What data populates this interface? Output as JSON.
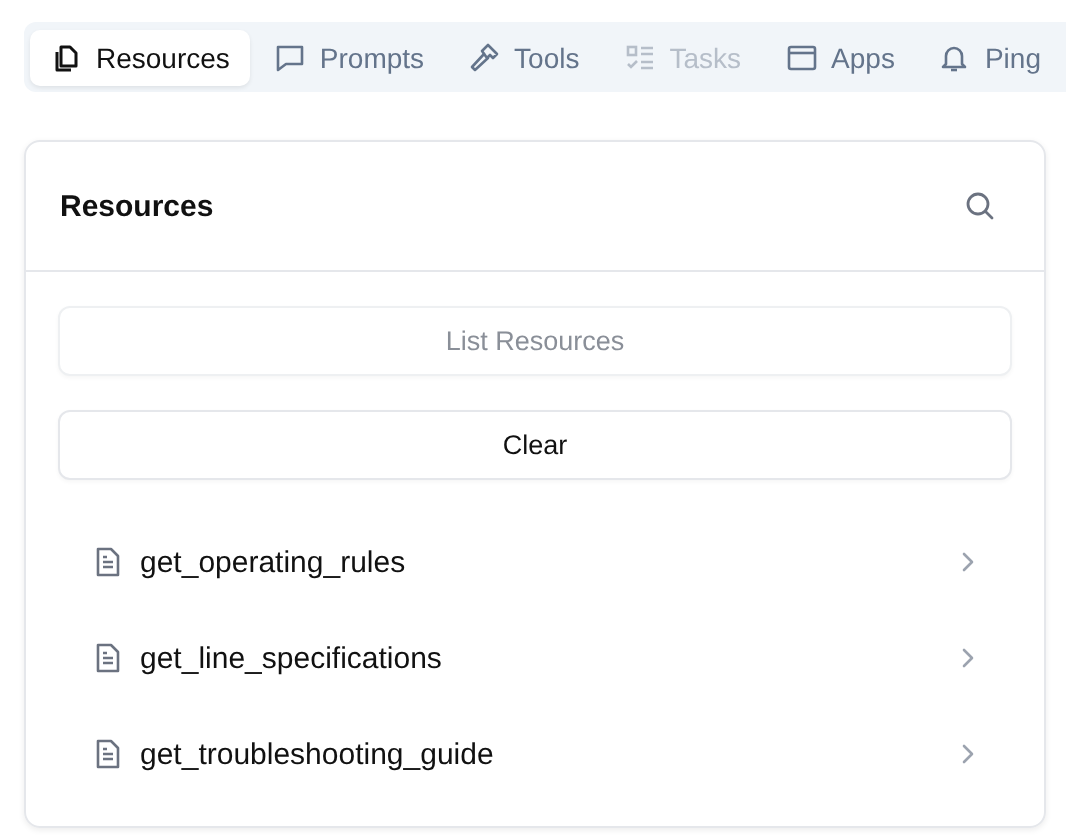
{
  "tabs": [
    {
      "label": "Resources",
      "kind": "copy",
      "selected": true,
      "disabled": false
    },
    {
      "label": "Prompts",
      "kind": "message",
      "selected": false,
      "disabled": false
    },
    {
      "label": "Tools",
      "kind": "hammer",
      "selected": false,
      "disabled": false
    },
    {
      "label": "Tasks",
      "kind": "checklist",
      "selected": false,
      "disabled": true
    },
    {
      "label": "Apps",
      "kind": "window",
      "selected": false,
      "disabled": false
    },
    {
      "label": "Ping",
      "kind": "bell",
      "selected": false,
      "disabled": false
    }
  ],
  "panel": {
    "title": "Resources",
    "buttons": [
      {
        "label": "List Resources",
        "disabled": true
      },
      {
        "label": "Clear",
        "disabled": false
      }
    ],
    "items": [
      {
        "name": "get_operating_rules"
      },
      {
        "name": "get_line_specifications"
      },
      {
        "name": "get_troubleshooting_guide"
      }
    ]
  }
}
